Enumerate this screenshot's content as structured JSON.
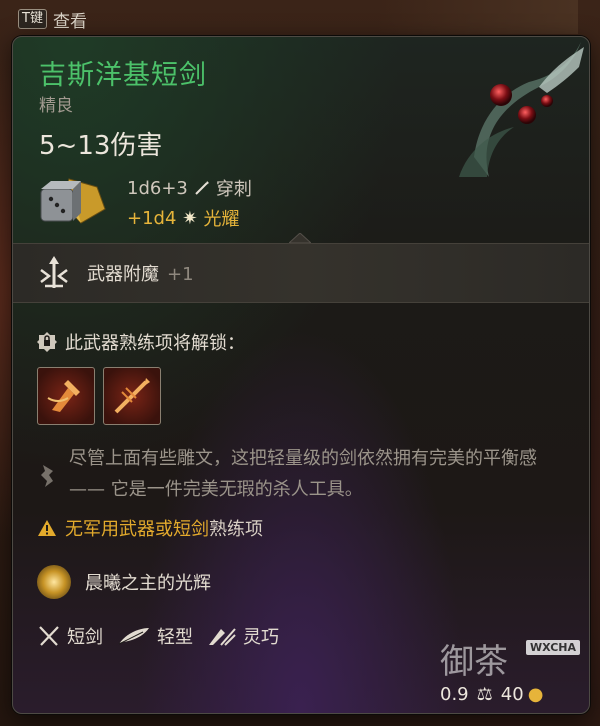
{
  "hint": {
    "key": "T键",
    "label": "查看"
  },
  "item": {
    "name": "吉斯洋基短剑",
    "rarity": "精良",
    "damage_range": "5~13伤害",
    "damage_dice": "1d6+3",
    "damage_type": "穿刺",
    "bonus_dice": "+1d4",
    "bonus_type": "光耀",
    "enchant_label": "武器附魔",
    "enchant_value": "+1",
    "unlock_header": "此武器熟练项将解锁：",
    "description": "尽管上面有些雕文，这把轻量级的剑依然拥有完美的平衡感 —— 它是一件完美无瑕的杀人工具。",
    "warning_part1": "无军用武器或短剑",
    "warning_part2": "熟练项",
    "boon": "晨曦之主的光辉",
    "properties": [
      "短剑",
      "轻型",
      "灵巧"
    ],
    "weight": "0.9",
    "value": "40"
  },
  "watermark": {
    "text": "御茶",
    "tag": "WXCHA"
  },
  "colors": {
    "title": "#4cc26a",
    "bonus": "#e6b43a",
    "warning": "#e3aa2c"
  }
}
